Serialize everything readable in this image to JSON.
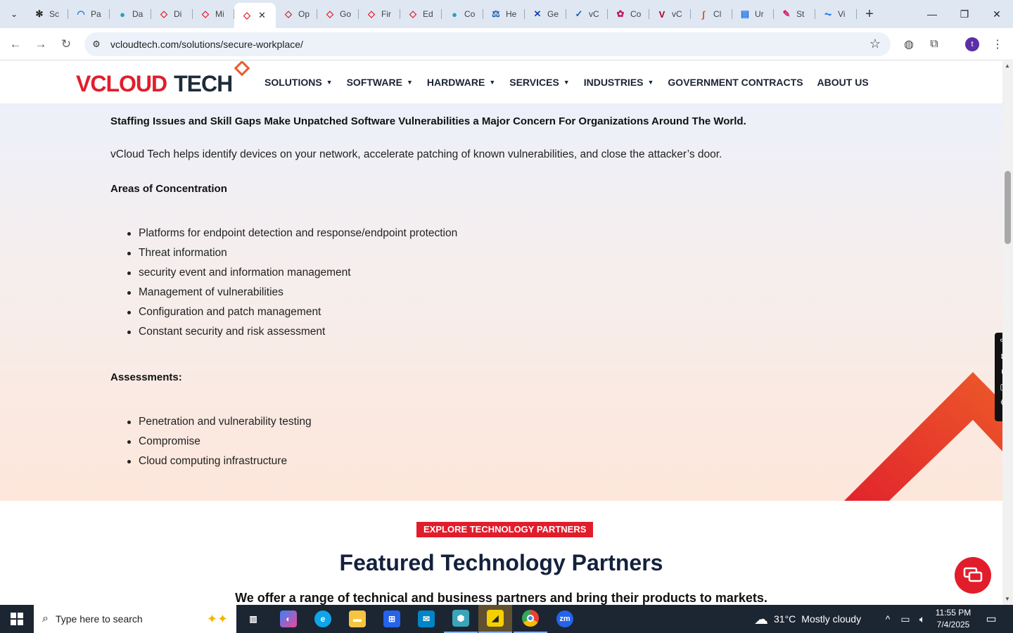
{
  "browser": {
    "tabs": [
      {
        "label": "Sc",
        "icon": "gear-icon",
        "color": "#222222",
        "glyph": "✻"
      },
      {
        "label": "Pa",
        "icon": "gauge-icon",
        "color": "#1a73e8",
        "glyph": "◠"
      },
      {
        "label": "Da",
        "icon": "circle-icon",
        "color": "#2aa0b8",
        "glyph": "●"
      },
      {
        "label": "Di",
        "icon": "diamond-icon",
        "color": "#e11d2c",
        "glyph": "◇"
      },
      {
        "label": "Mi",
        "icon": "diamond-icon",
        "color": "#e11d2c",
        "glyph": "◇"
      },
      {
        "label": "",
        "icon": "diamond-icon",
        "color": "#e11d2c",
        "glyph": "◇",
        "active": true
      },
      {
        "label": "Op",
        "icon": "diamond-icon",
        "color": "#e11d2c",
        "glyph": "◇"
      },
      {
        "label": "Go",
        "icon": "diamond-icon",
        "color": "#e11d2c",
        "glyph": "◇"
      },
      {
        "label": "Fir",
        "icon": "diamond-icon",
        "color": "#e11d2c",
        "glyph": "◇"
      },
      {
        "label": "Ed",
        "icon": "diamond-icon",
        "color": "#e11d2c",
        "glyph": "◇"
      },
      {
        "label": "Co",
        "icon": "circle-icon",
        "color": "#2aa0b8",
        "glyph": "●"
      },
      {
        "label": "He",
        "icon": "scale-icon",
        "color": "#1a5fb4",
        "glyph": "⚖"
      },
      {
        "label": "Ge",
        "icon": "x-icon",
        "color": "#1a3fb4",
        "glyph": "✕"
      },
      {
        "label": "vC",
        "icon": "check-icon",
        "color": "#1a5fb4",
        "glyph": "✓"
      },
      {
        "label": "Co",
        "icon": "badge-icon",
        "color": "#c2185b",
        "glyph": "✿"
      },
      {
        "label": "vC",
        "icon": "v-icon",
        "color": "#b00020",
        "glyph": "V"
      },
      {
        "label": "Cl",
        "icon": "pen-icon",
        "color": "#e64a19",
        "glyph": "∫"
      },
      {
        "label": "Ur",
        "icon": "doc-icon",
        "color": "#1a73e8",
        "glyph": "▤"
      },
      {
        "label": "St",
        "icon": "pin-icon",
        "color": "#d81b60",
        "glyph": "✎"
      },
      {
        "label": "Vi",
        "icon": "pulse-icon",
        "color": "#1a73e8",
        "glyph": "⏦"
      }
    ],
    "url": "vcloudtech.com/solutions/secure-workplace/",
    "avatar_letter": "t"
  },
  "site": {
    "logo": {
      "v": "V",
      "cloud": "CLOUD",
      "tech": "TECH"
    },
    "nav": [
      {
        "label": "SOLUTIONS",
        "caret": true
      },
      {
        "label": "SOFTWARE",
        "caret": true
      },
      {
        "label": "HARDWARE",
        "caret": true
      },
      {
        "label": "SERVICES",
        "caret": true
      },
      {
        "label": "INDUSTRIES",
        "caret": true
      },
      {
        "label": "GOVERNMENT CONTRACTS",
        "caret": false
      },
      {
        "label": "ABOUT US",
        "caret": false
      }
    ],
    "headline": "Staffing Issues and Skill Gaps Make Unpatched Software Vulnerabilities a Major Concern For Organizations Around The World.",
    "intro": "vCloud Tech helps identify devices on your network, accelerate patching of known vulnerabilities, and close the attacker’s door.",
    "areas_heading": "Areas of Concentration",
    "areas": [
      "Platforms for endpoint detection and response/endpoint protection",
      "Threat information",
      "security event and information management",
      "Management of vulnerabilities",
      "Configuration and patch management",
      "Constant security and risk assessment"
    ],
    "assessments_heading": "Assessments:",
    "assessments": [
      "Penetration and vulnerability testing",
      "Compromise",
      "Cloud computing infrastructure"
    ],
    "partners_button": "EXPLORE TECHNOLOGY PARTNERS",
    "partners_title": "Featured Technology Partners",
    "partners_subtitle": "We offer a range of technical and business partners and bring their products to markets."
  },
  "taskbar": {
    "search_placeholder": "Type here to search",
    "weather": {
      "temp": "31°C",
      "condition": "Mostly cloudy"
    },
    "time": "11:55 PM",
    "date": "7/4/2025"
  },
  "colors": {
    "brand_red": "#e11d2c",
    "brand_navy": "#14213d",
    "brand_orange": "#ec5a2a"
  }
}
